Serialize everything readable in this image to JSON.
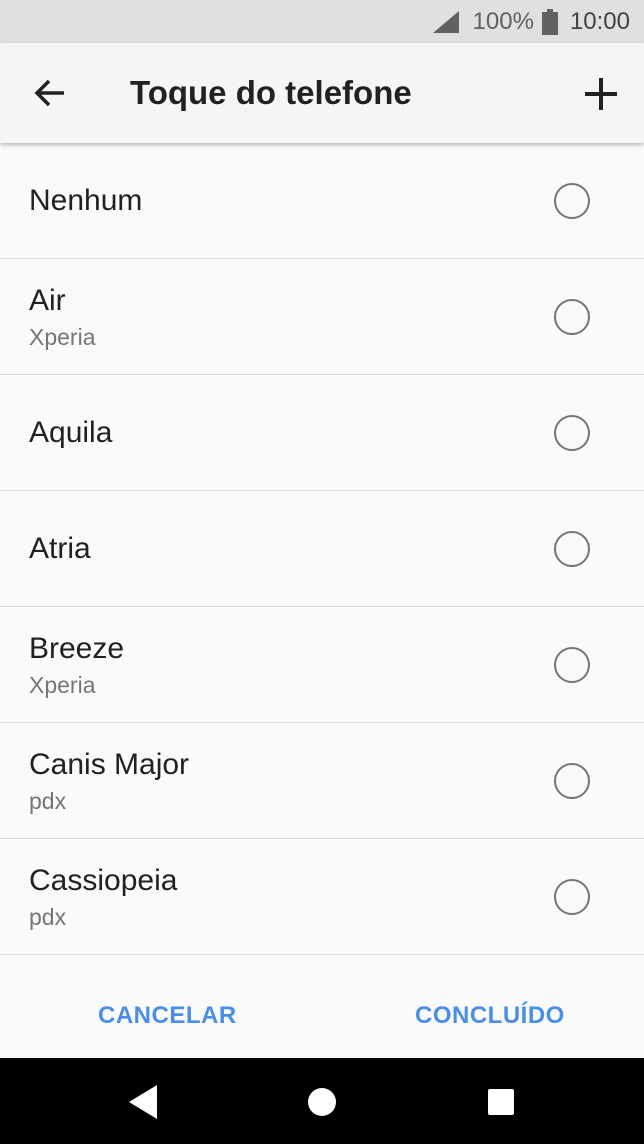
{
  "status_bar": {
    "battery_percent": "100%",
    "time": "10:00",
    "icons": [
      "signal-icon",
      "battery-icon"
    ]
  },
  "app_bar": {
    "title": "Toque do telefone",
    "icons": [
      "back-arrow-icon",
      "add-icon"
    ]
  },
  "ringtones": [
    {
      "name": "Nenhum",
      "source": ""
    },
    {
      "name": "Air",
      "source": "Xperia"
    },
    {
      "name": "Aquila",
      "source": ""
    },
    {
      "name": "Atria",
      "source": ""
    },
    {
      "name": "Breeze",
      "source": "Xperia"
    },
    {
      "name": "Canis Major",
      "source": "pdx"
    },
    {
      "name": "Cassiopeia",
      "source": "pdx"
    }
  ],
  "actions": {
    "cancel_label": "CANCELAR",
    "done_label": "CONCLUÍDO"
  },
  "nav_bar": {
    "icons": [
      "nav-back-icon",
      "nav-home-icon",
      "nav-recents-icon"
    ]
  },
  "colors": {
    "accent": "#4a8fe7",
    "status_bar_bg": "#e0e0e0",
    "nav_bar_bg": "#000000"
  }
}
